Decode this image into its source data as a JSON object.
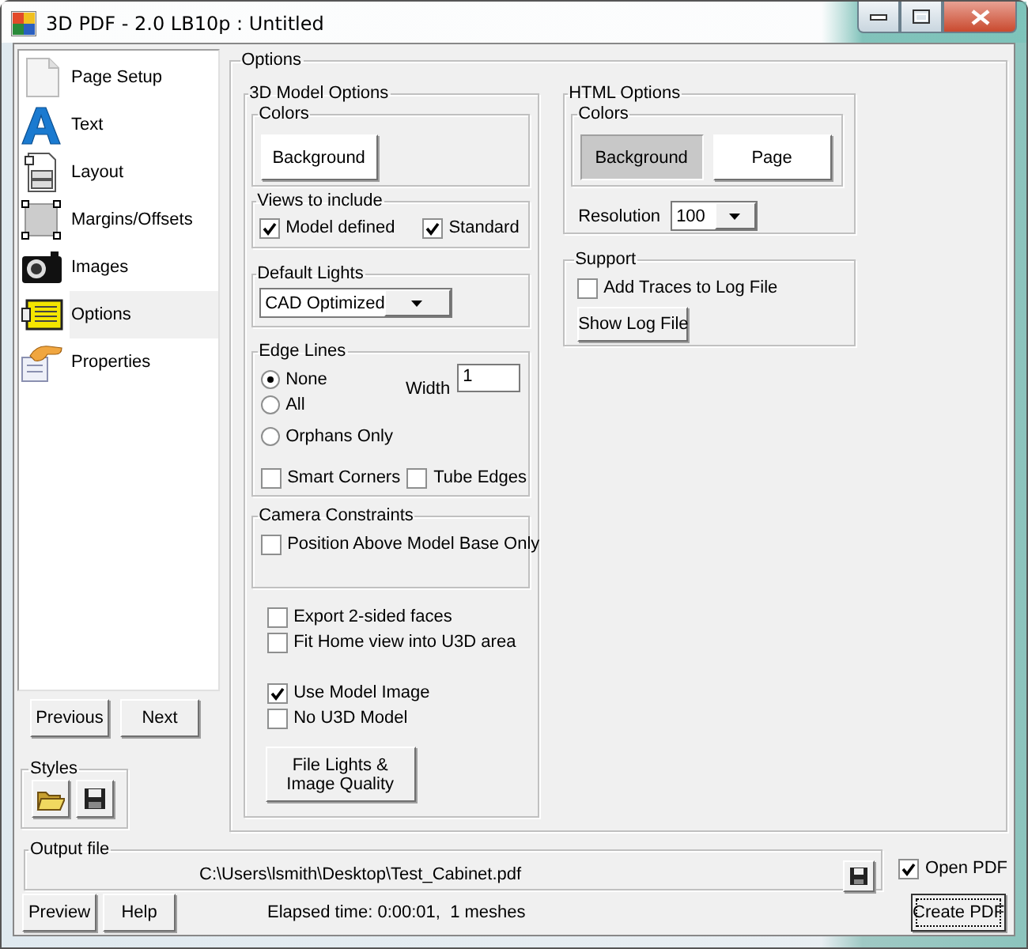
{
  "window": {
    "title": "3D PDF - 2.0 LB10p : Untitled"
  },
  "sidebar": {
    "items": [
      {
        "label": "Page Setup",
        "kind": "page",
        "selected": false
      },
      {
        "label": "Text",
        "kind": "text",
        "selected": false
      },
      {
        "label": "Layout",
        "kind": "layout",
        "selected": false
      },
      {
        "label": "Margins/Offsets",
        "kind": "margins",
        "selected": false
      },
      {
        "label": "Images",
        "kind": "images",
        "selected": false
      },
      {
        "label": "Options",
        "kind": "options",
        "selected": true
      },
      {
        "label": "Properties",
        "kind": "properties",
        "selected": false
      }
    ]
  },
  "nav_buttons": [
    "Previous",
    "Next"
  ],
  "styles": {
    "title": "Styles"
  },
  "options": {
    "title": "Options",
    "model_options": {
      "title": "3D Model Options",
      "colors": {
        "title": "Colors",
        "buttons": [
          {
            "label": "Background",
            "pressed": false
          }
        ]
      },
      "views": {
        "title": "Views to include",
        "checkboxes": [
          {
            "label": "Model defined",
            "checked": true
          },
          {
            "label": "Standard",
            "checked": true
          }
        ]
      },
      "lights": {
        "title": "Default Lights",
        "value": "CAD Optimized"
      },
      "edge_lines": {
        "title": "Edge Lines",
        "radios": [
          {
            "label": "None",
            "selected": true
          },
          {
            "label": "All",
            "selected": false
          },
          {
            "label": "Orphans Only",
            "selected": false
          }
        ],
        "width_label": "Width",
        "width_value": "1",
        "checkboxes": [
          {
            "label": "Smart Corners",
            "checked": false
          },
          {
            "label": "Tube Edges",
            "checked": false
          }
        ]
      },
      "camera": {
        "title": "Camera Constraints",
        "checkboxes": [
          {
            "label": "Position Above Model Base Only",
            "checked": false
          }
        ]
      },
      "export_checkboxes": [
        {
          "label": "Export 2-sided faces",
          "checked": false
        },
        {
          "label": "Fit Home view into U3D area",
          "checked": false
        }
      ],
      "image_checkboxes": [
        {
          "label": "Use Model Image",
          "checked": true
        },
        {
          "label": "No U3D Model",
          "checked": false
        }
      ],
      "quality_button": "File Lights & Image Quality"
    },
    "html_options": {
      "title": "HTML Options",
      "colors": {
        "title": "Colors",
        "buttons": [
          {
            "label": "Background",
            "pressed": true
          },
          {
            "label": "Page",
            "pressed": false
          }
        ]
      },
      "resolution_label": "Resolution",
      "resolution_value": "100"
    },
    "support": {
      "title": "Support",
      "checkboxes": [
        {
          "label": "Add Traces to Log File",
          "checked": false
        }
      ],
      "button": "Show Log File"
    }
  },
  "output_file": {
    "title": "Output file",
    "path": "C:\\Users\\lsmith\\Desktop\\Test_Cabinet.pdf"
  },
  "open_pdf": {
    "label": "Open PDF",
    "checked": true
  },
  "footer": {
    "buttons": [
      "Preview",
      "Help"
    ],
    "status": "Elapsed time: 0:00:01,  1 meshes",
    "create_button": "Create PDF"
  }
}
